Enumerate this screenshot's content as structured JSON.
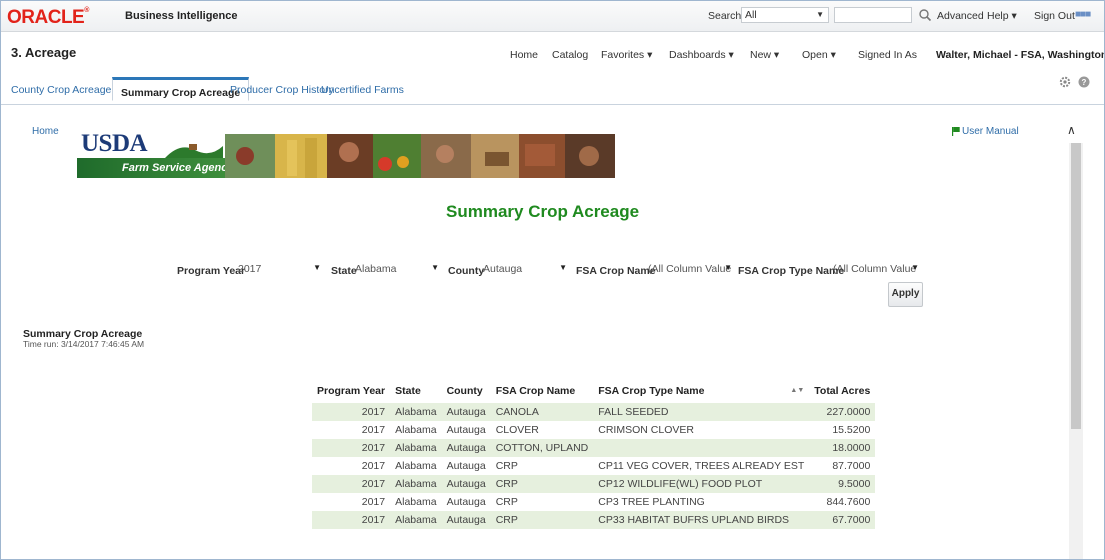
{
  "topbar": {
    "logo": "ORACLE",
    "product": "Business Intelligence",
    "search_label": "Search",
    "search_scope": "All",
    "advanced": "Advanced",
    "help": "Help ▾",
    "sign_out": "Sign Out"
  },
  "header": {
    "title": "3. Acreage",
    "nav": {
      "home": "Home",
      "catalog": "Catalog",
      "favorites": "Favorites ▾",
      "dashboards": "Dashboards ▾",
      "new": "New ▾",
      "open": "Open ▾"
    },
    "signed_in_label": "Signed In As",
    "signed_in_user": "Walter, Michael - FSA, Washington, DC ▾"
  },
  "tabs": [
    "County Crop Acreage",
    "Summary Crop Acreage",
    "Producer Crop History",
    "Uncertified Farms"
  ],
  "content": {
    "home_link": "Home",
    "usda": "USDA",
    "agency": "Farm Service Agency",
    "user_manual": "User Manual",
    "report_title": "Summary Crop Acreage",
    "prompts": {
      "program_year_label": "Program Year",
      "program_year_value": "2017",
      "state_label": "State",
      "state_value": "Alabama",
      "county_label": "County",
      "county_value": "Autauga",
      "crop_name_label": "FSA Crop Name",
      "crop_name_value": "(All Column Value",
      "crop_type_label": "FSA Crop Type Name",
      "crop_type_value": "(All Column Value"
    },
    "apply": "Apply",
    "section_title": "Summary Crop Acreage",
    "time_run": "Time run: 3/14/2017 7:46:45 AM"
  },
  "table": {
    "headers": [
      "Program Year",
      "State",
      "County",
      "FSA Crop Name",
      "FSA Crop Type Name",
      "Total Acres"
    ],
    "rows": [
      [
        "2017",
        "Alabama",
        "Autauga",
        "CANOLA",
        "FALL SEEDED",
        "227.0000"
      ],
      [
        "2017",
        "Alabama",
        "Autauga",
        "CLOVER",
        "CRIMSON CLOVER",
        "15.5200"
      ],
      [
        "2017",
        "Alabama",
        "Autauga",
        "COTTON, UPLAND",
        "",
        "18.0000"
      ],
      [
        "2017",
        "Alabama",
        "Autauga",
        "CRP",
        "CP11 VEG COVER, TREES ALREADY EST",
        "87.7000"
      ],
      [
        "2017",
        "Alabama",
        "Autauga",
        "CRP",
        "CP12 WILDLIFE(WL) FOOD PLOT",
        "9.5000"
      ],
      [
        "2017",
        "Alabama",
        "Autauga",
        "CRP",
        "CP3 TREE PLANTING",
        "844.7600"
      ],
      [
        "2017",
        "Alabama",
        "Autauga",
        "CRP",
        "CP33 HABITAT BUFRS UPLAND BIRDS",
        "67.7000"
      ]
    ]
  },
  "colors": {
    "oracle_red": "#e2231a",
    "title_green": "#1f8a1f",
    "row_band": "#e6f0de",
    "link_blue": "#2f6da8"
  }
}
